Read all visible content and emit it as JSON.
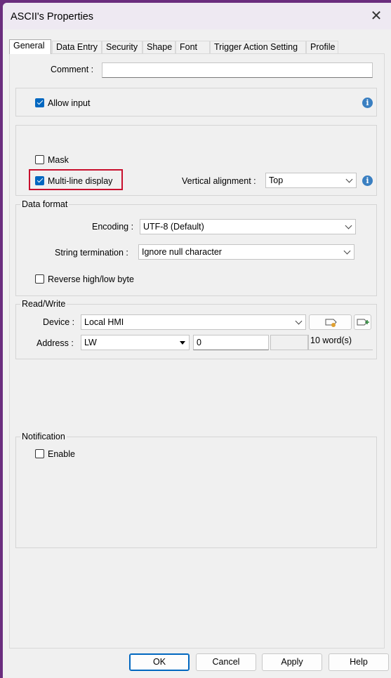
{
  "window": {
    "title": "ASCII's Properties",
    "close_glyph": "✕"
  },
  "tabs": [
    {
      "label": "General",
      "active": true
    },
    {
      "label": "Data Entry"
    },
    {
      "label": "Security"
    },
    {
      "label": "Shape"
    },
    {
      "label": "Font"
    },
    {
      "label": "Trigger Action Setting"
    },
    {
      "label": "Profile"
    }
  ],
  "general": {
    "comment_label": "Comment :",
    "comment_value": "",
    "allow_input_label": "Allow input",
    "allow_input_checked": true,
    "mask_label": "Mask",
    "mask_checked": false,
    "multiline_label": "Multi-line display",
    "multiline_checked": true,
    "vertical_alignment_label": "Vertical alignment :",
    "vertical_alignment_value": "Top"
  },
  "data_format": {
    "title": "Data format",
    "encoding_label": "Encoding :",
    "encoding_value": "UTF-8 (Default)",
    "termination_label": "String termination :",
    "termination_value": "Ignore null character",
    "reverse_label": "Reverse high/low byte",
    "reverse_checked": false
  },
  "read_write": {
    "title": "Read/Write",
    "device_label": "Device :",
    "device_value": "Local HMI",
    "address_label": "Address :",
    "address_type": "LW",
    "address_value": "0",
    "address_extra": "",
    "size_text": "10 word(s)"
  },
  "notification": {
    "title": "Notification",
    "enable_label": "Enable",
    "enable_checked": false
  },
  "buttons": {
    "ok": "OK",
    "cancel": "Cancel",
    "apply": "Apply",
    "help": "Help"
  },
  "colors": {
    "accent": "#0067c0",
    "highlight_box": "#c8102e",
    "info": "#3a7fc1"
  }
}
